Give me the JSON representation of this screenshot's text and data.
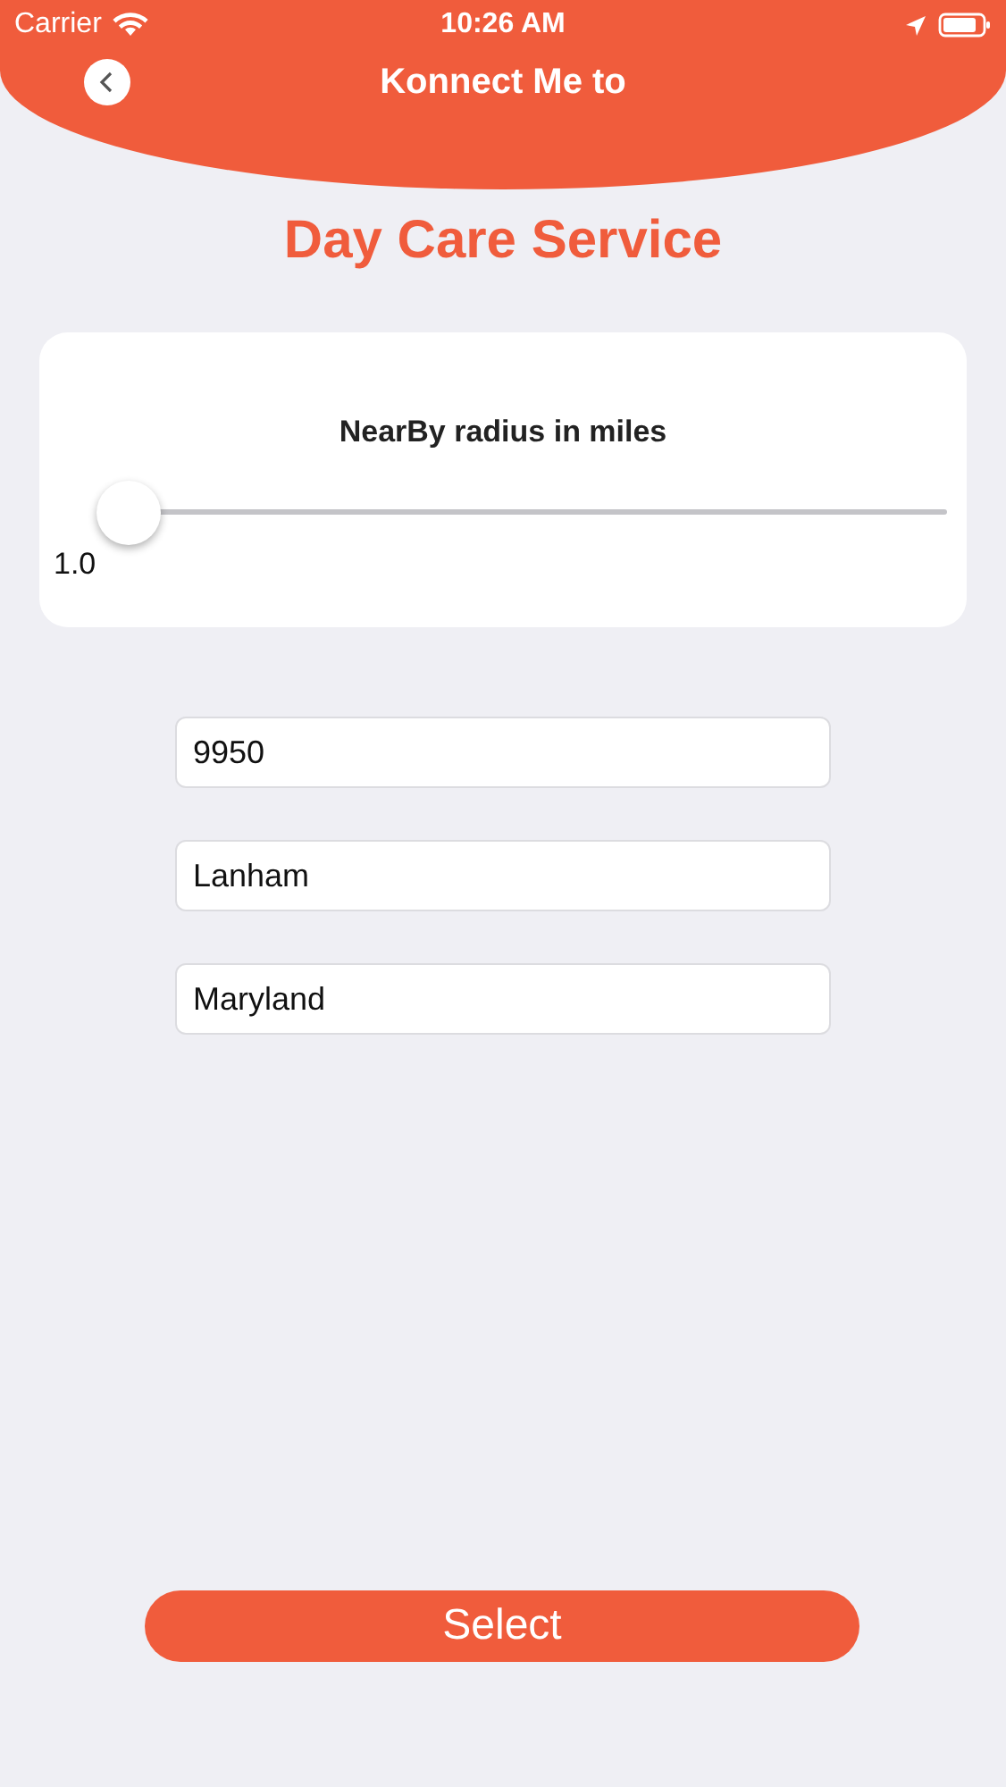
{
  "status_bar": {
    "carrier": "Carrier",
    "time": "10:26 AM"
  },
  "nav_bar": {
    "title": "Konnect Me to"
  },
  "heading": "Day Care Service",
  "radius_card": {
    "label": "NearBy radius in miles",
    "slider": {
      "level": 0
    },
    "reading": "1.0"
  },
  "fields": [
    {
      "value": "9950"
    },
    {
      "value": "Lanham"
    },
    {
      "value": "Maryland"
    }
  ],
  "button": {
    "label": "Select"
  }
}
